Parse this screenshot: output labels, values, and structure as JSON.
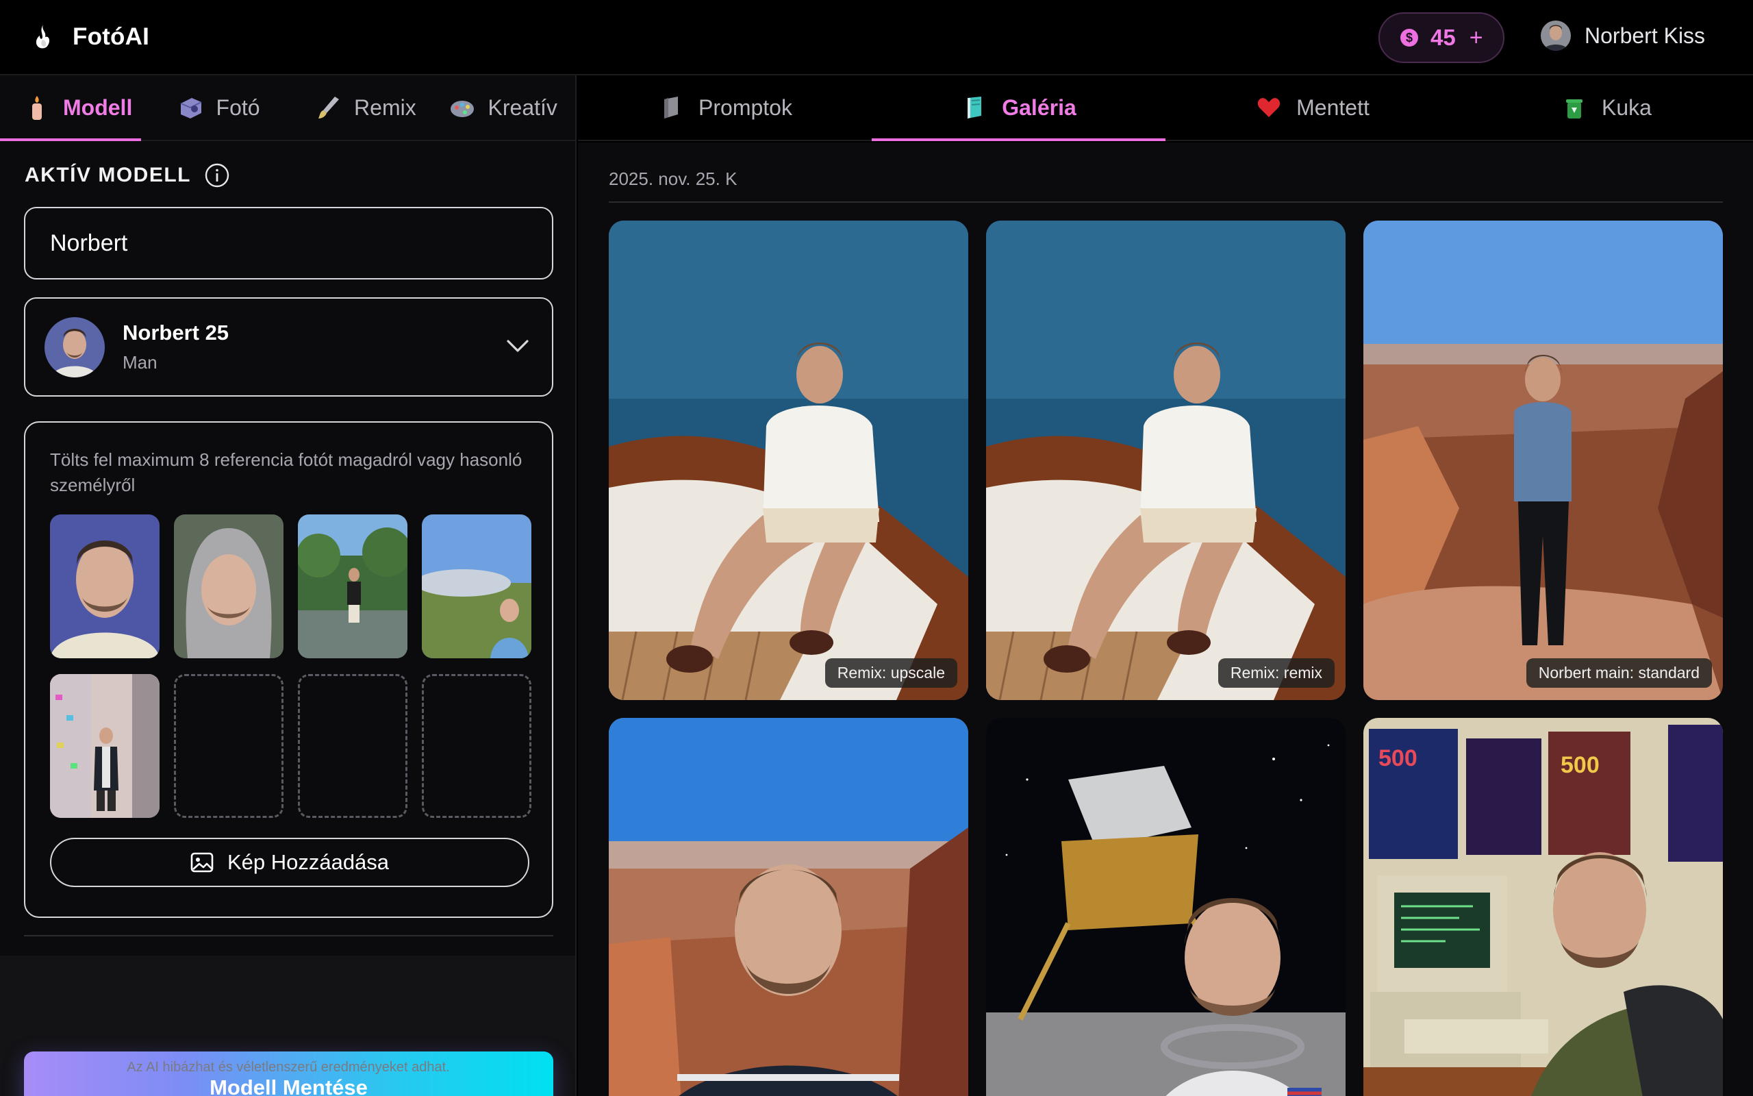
{
  "app": {
    "name": "FotóAI"
  },
  "credits": {
    "count": "45",
    "coin_symbol": "$",
    "add_symbol": "+"
  },
  "user": {
    "name": "Norbert Kiss"
  },
  "left_tabs": [
    {
      "label": "Modell",
      "icon": "candle-icon",
      "active": true
    },
    {
      "label": "Fotó",
      "icon": "camera-icon",
      "active": false
    },
    {
      "label": "Remix",
      "icon": "brush-icon",
      "active": false
    },
    {
      "label": "Kreatív",
      "icon": "palette-icon",
      "active": false
    }
  ],
  "model": {
    "section_title": "AKTÍV MODELL",
    "name_value": "Norbert",
    "selected": {
      "name": "Norbert 25",
      "gender": "Man"
    },
    "reference_hint": "Tölts fel maximum 8 referencia fotót magadról vagy hasonló személyről",
    "add_image_label": "Kép Hozzáadása",
    "save_label": "Modell Mentése",
    "disclaimer": "Az AI hibázhat és véletlenszerű eredményeket adhat."
  },
  "right_tabs": [
    {
      "label": "Promptok",
      "icon": "tag-icon",
      "active": false
    },
    {
      "label": "Galéria",
      "icon": "book-icon",
      "active": true
    },
    {
      "label": "Mentett",
      "icon": "heart-icon",
      "active": false
    },
    {
      "label": "Kuka",
      "icon": "trash-icon",
      "active": false
    }
  ],
  "gallery": {
    "date": "2025. nov. 25. K",
    "items": [
      {
        "label": "Remix: upscale"
      },
      {
        "label": "Remix: remix"
      },
      {
        "label": "Norbert main: standard"
      },
      {
        "label": ""
      },
      {
        "label": ""
      },
      {
        "label": ""
      }
    ]
  },
  "colors": {
    "accent": "#ec6fe2",
    "background": "#000000",
    "panel": "#0b0b0d"
  }
}
